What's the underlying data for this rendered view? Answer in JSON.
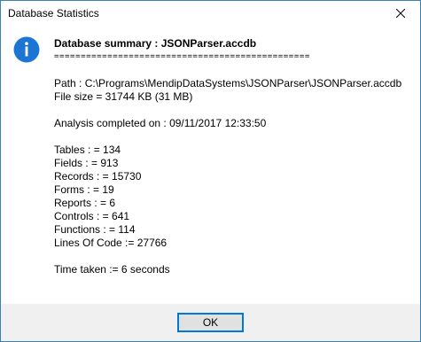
{
  "window": {
    "title": "Database Statistics",
    "close_icon": "close-icon"
  },
  "dialog": {
    "icon": "info-icon",
    "heading": "Database summary : JSONParser.accdb",
    "separator": "================================================",
    "path": "Path : C:\\Programs\\MendipDataSystems\\JSONParser\\JSONParser.accdb",
    "file_size": "File size = 31744 KB   (31 MB)",
    "analysis": "Analysis completed on : 09/11/2017 12:33:50",
    "stats": [
      "Tables : = 134",
      "Fields : = 913",
      "Records : = 15730",
      "Forms : = 19",
      "Reports : = 6",
      "Controls : = 641",
      "Functions : = 114",
      "Lines Of Code := 27766"
    ],
    "time_taken": "Time taken := 6 seconds"
  },
  "buttons": {
    "ok_label": "OK"
  },
  "colors": {
    "accent": "#0078d7",
    "icon_blue": "#1c75d2",
    "border": "#3c7fb1"
  }
}
